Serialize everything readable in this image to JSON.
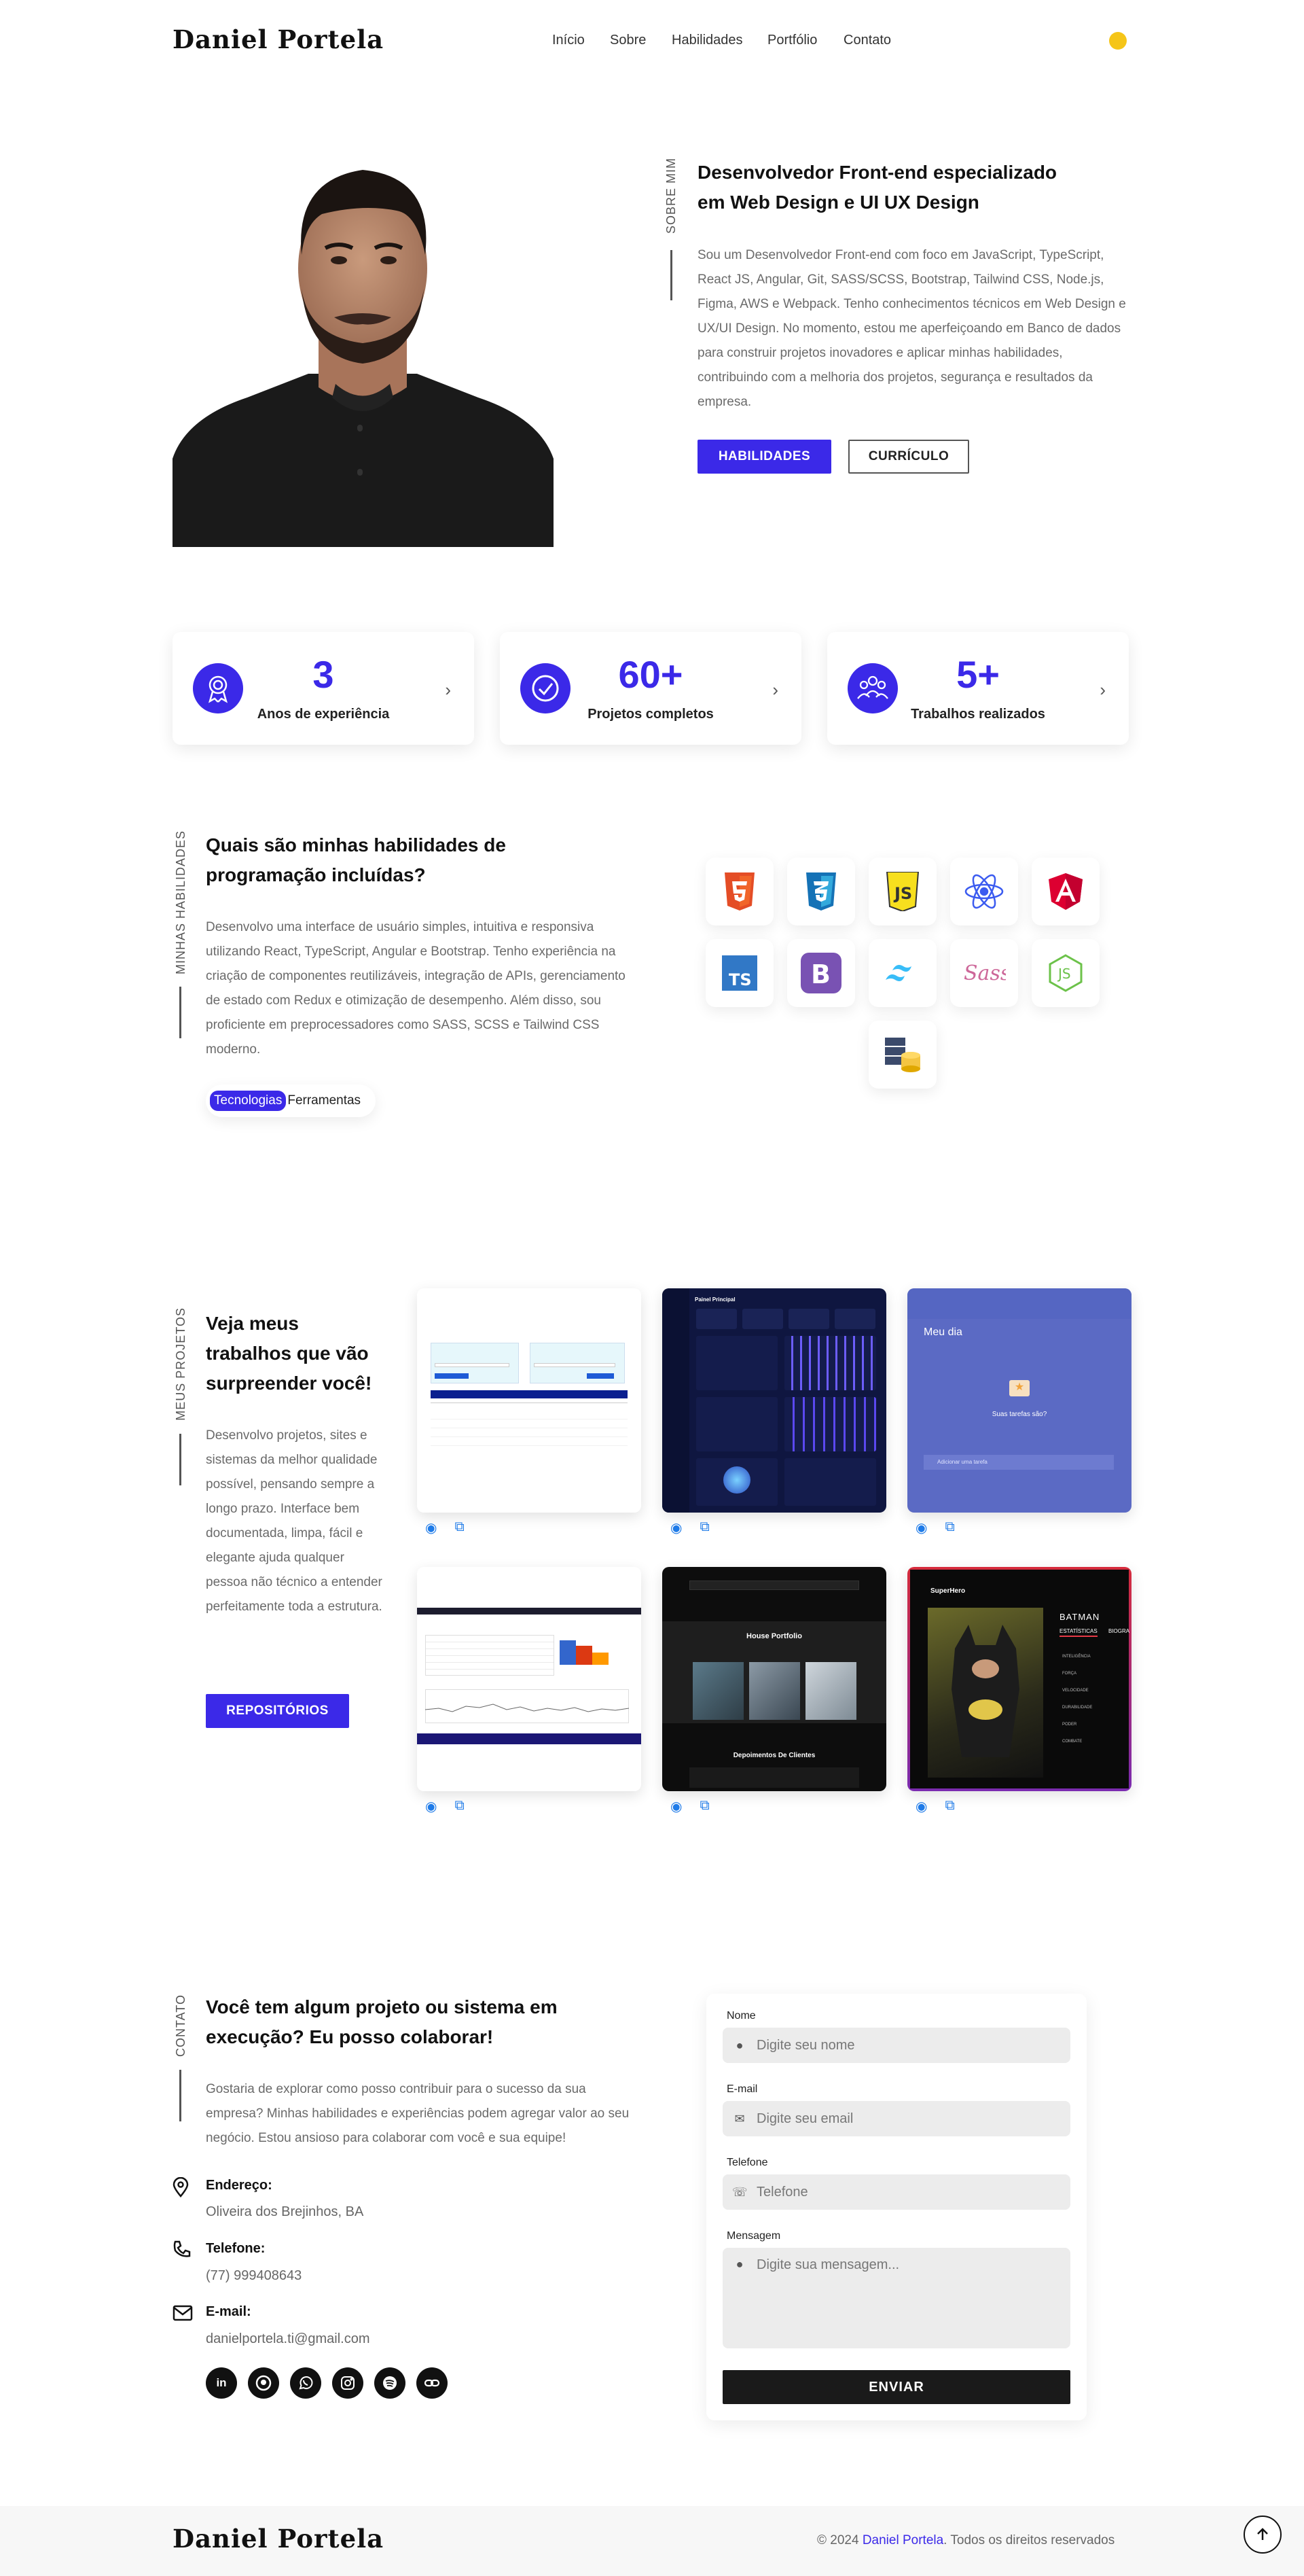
{
  "brand": "Daniel Portela",
  "nav": {
    "items": [
      "Início",
      "Sobre",
      "Habilidades",
      "Portfólio",
      "Contato"
    ]
  },
  "colors": {
    "accent": "#3b29e8",
    "theme_toggle": "#f5c518",
    "text": "#222222",
    "muted": "#6a6a6a"
  },
  "about": {
    "vertical_label": "SOBRE MIM",
    "title": "Desenvolvedor Front-end especializado em Web Design e UI UX Design",
    "text": "Sou um Desenvolvedor Front-end com foco em JavaScript, TypeScript, React JS, Angular, Git, SASS/SCSS, Bootstrap, Tailwind CSS, Node.js, Figma, AWS e Webpack. Tenho conhecimentos técnicos em Web Design e UX/UI Design. No momento, estou me aperfeiçoando em Banco de dados para construir projetos inovadores e aplicar minhas habilidades, contribuindo com a melhoria dos projetos, segurança e resultados da empresa.",
    "btn_skills": "HABILIDADES",
    "btn_cv": "CURRÍCULO"
  },
  "stats": [
    {
      "value": "3",
      "label": "Anos de experiência",
      "icon": "award-icon"
    },
    {
      "value": "60+",
      "label": "Projetos completos",
      "icon": "check-circle-icon"
    },
    {
      "value": "5+",
      "label": "Trabalhos realizados",
      "icon": "team-icon"
    }
  ],
  "skills": {
    "vertical_label": "MINHAS HABILIDADES",
    "title": "Quais são minhas habilidades de programação incluídas?",
    "text": "Desenvolvo uma interface de usuário simples, intuitiva e responsiva utilizando React, TypeScript, Angular e Bootstrap. Tenho experiência na criação de componentes reutilizáveis, integração de APIs, gerenciamento de estado com Redux e otimização de desempenho. Além disso, sou proficiente em preprocessadores como SASS, SCSS e Tailwind CSS moderno.",
    "tabs": [
      "Tecnologias",
      "Ferramentas"
    ],
    "icons": [
      "html5-icon",
      "css3-icon",
      "javascript-icon",
      "react-icon",
      "angular-icon",
      "typescript-icon",
      "bootstrap-icon",
      "tailwind-icon",
      "sass-icon",
      "nodejs-icon",
      "database-icon"
    ]
  },
  "projects": {
    "vertical_label": "MEUS PROJETOS",
    "title": "Veja meus trabalhos que vão surpreender você!",
    "text": "Desenvolvo projetos, sites e sistemas da melhor qualidade possível, pensando sempre a longo prazo. Interface bem documentada, limpa, fácil e elegante ajuda qualquer pessoa não técnico a entender perfeitamente toda a estrutura.",
    "btn": "REPOSITÓRIOS",
    "items": [
      {
        "name": "form-table-project"
      },
      {
        "name": "dashboard-dark-project",
        "heading": "Painel Principal"
      },
      {
        "name": "tasks-project",
        "heading": "Meu dia",
        "subheading": "Suas tarefas são?",
        "input": "Adicionar uma tarefa"
      },
      {
        "name": "charts-project"
      },
      {
        "name": "house-portfolio-project",
        "heading": "House Portfolio",
        "subheading": "Depoimentos De Clientes"
      },
      {
        "name": "superhero-project",
        "logo": "SuperHero",
        "hero": "BATMAN",
        "tab1": "ESTATÍSTICAS",
        "tab2": "BIOGRA",
        "stats": [
          "INTELIGÊNCIA",
          "FORÇA",
          "VELOCIDADE",
          "DURABILIDADE",
          "PODER",
          "COMBATE"
        ]
      }
    ]
  },
  "contact": {
    "vertical_label": "CONTATO",
    "title": "Você tem algum projeto ou sistema em execução? Eu posso colaborar!",
    "text": "Gostaria de explorar como posso contribuir para o sucesso da sua empresa? Minhas habilidades e experiências podem agregar valor ao seu negócio. Estou ansioso para colaborar com você e sua equipe!",
    "address_label": "Endereço:",
    "address": "Oliveira dos Brejinhos, BA",
    "phone_label": "Telefone:",
    "phone": "(77) 999408643",
    "email_label": "E-mail:",
    "email": "danielportela.ti@gmail.com",
    "social": [
      "linkedin-icon",
      "github-icon",
      "whatsapp-icon",
      "instagram-icon",
      "spotify-icon",
      "link-icon"
    ]
  },
  "form": {
    "name_label": "Nome",
    "name_placeholder": "Digite seu nome",
    "email_label": "E-mail",
    "email_placeholder": "Digite seu email",
    "phone_label": "Telefone",
    "phone_placeholder": "Telefone",
    "msg_label": "Mensagem",
    "msg_placeholder": "Digite sua mensagem...",
    "submit": "ENVIAR"
  },
  "footer": {
    "brand": "Daniel Portela",
    "copy_prefix": "© 2024",
    "copy_name": "Daniel Portela",
    "copy_suffix": ". Todos os direitos reservados"
  }
}
